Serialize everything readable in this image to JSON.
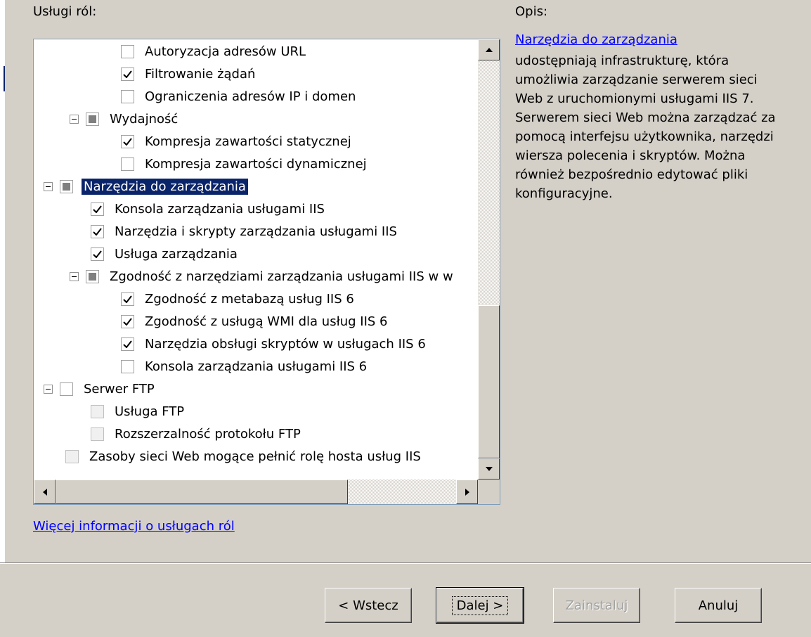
{
  "left_panel": {
    "title": "Usługi ról:"
  },
  "right_panel": {
    "title": "Opis:",
    "link": "Narzędzia do zarządzania",
    "text": "udostępniają infrastrukturę, która umożliwia zarządzanie serwerem sieci Web z uruchomionymi usługami IIS 7. Serwerem sieci Web można zarządzać za pomocą interfejsu użytkownika, narzędzi wiersza polecenia i skryptów. Można również bezpośrednio edytować pliki konfiguracyjne."
  },
  "tree": {
    "items": [
      {
        "label": "Autoryzacja adresów URL",
        "level": 3,
        "state": "unchecked",
        "expander": false
      },
      {
        "label": "Filtrowanie żądań",
        "level": 3,
        "state": "checked",
        "expander": false
      },
      {
        "label": "Ograniczenia adresów IP i domen",
        "level": 3,
        "state": "unchecked",
        "expander": false
      },
      {
        "label": "Wydajność",
        "level": 2,
        "state": "partial",
        "expander": true
      },
      {
        "label": "Kompresja zawartości statycznej",
        "level": 3,
        "state": "checked",
        "expander": false
      },
      {
        "label": "Kompresja zawartości dynamicznej",
        "level": 3,
        "state": "unchecked",
        "expander": false
      },
      {
        "label": "Narzędzia do zarządzania",
        "level": 1,
        "state": "partial",
        "expander": true,
        "selected": true
      },
      {
        "label": "Konsola zarządzania usługami IIS",
        "level": 2,
        "state": "checked",
        "expander": false
      },
      {
        "label": "Narzędzia i skrypty zarządzania usługami IIS",
        "level": 2,
        "state": "checked",
        "expander": false
      },
      {
        "label": "Usługa zarządzania",
        "level": 2,
        "state": "checked",
        "expander": false
      },
      {
        "label": "Zgodność z narzędziami zarządzania usługami IIS w w",
        "level": 2,
        "state": "partial",
        "expander": true
      },
      {
        "label": "Zgodność z metabazą usług IIS 6",
        "level": 3,
        "state": "checked",
        "expander": false
      },
      {
        "label": "Zgodność z usługą WMI dla usług IIS 6",
        "level": 3,
        "state": "checked",
        "expander": false
      },
      {
        "label": "Narzędzia obsługi skryptów w usługach IIS 6",
        "level": 3,
        "state": "checked",
        "expander": false
      },
      {
        "label": "Konsola zarządzania usługami IIS 6",
        "level": 3,
        "state": "unchecked",
        "expander": false
      },
      {
        "label": "Serwer FTP",
        "level": 1,
        "state": "unchecked",
        "expander": true
      },
      {
        "label": "Usługa FTP",
        "level": 2,
        "state": "disabled",
        "expander": false
      },
      {
        "label": "Rozszerzalność protokołu FTP",
        "level": 2,
        "state": "disabled",
        "expander": false
      },
      {
        "label": "Zasoby sieci Web mogące pełnić rolę hosta usług IIS",
        "level": 1,
        "state": "disabled",
        "expander": false
      }
    ]
  },
  "footer": {
    "more_link": "Więcej informacji o usługach ról"
  },
  "buttons": {
    "back": "< Wstecz",
    "next": "Dalej >",
    "install": "Zainstaluj",
    "cancel": "Anuluj"
  },
  "icons": {
    "scroll_up": "arrow-up-icon",
    "scroll_down": "arrow-down-icon",
    "scroll_left": "arrow-left-icon",
    "scroll_right": "arrow-right-icon",
    "checkmark": "checkmark-icon",
    "collapse": "minus-icon"
  },
  "colors": {
    "selection": "#0a246a",
    "link": "#0000ff",
    "background": "#d4d0c8"
  }
}
